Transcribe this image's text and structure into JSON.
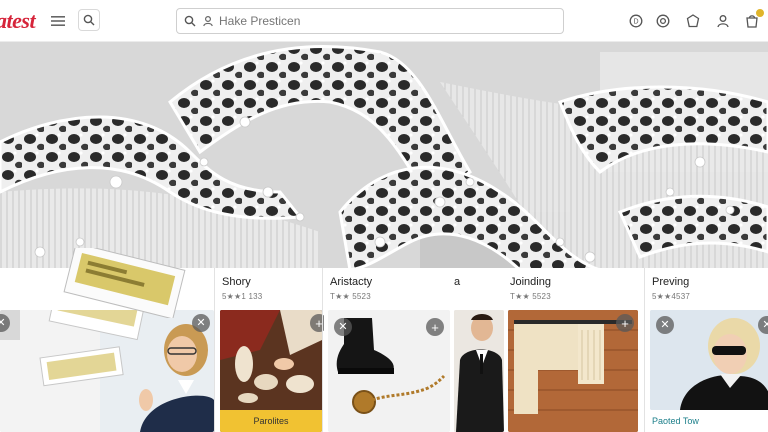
{
  "header": {
    "logo_text": "atest",
    "search_placeholder": "Hake Presticen",
    "icons": [
      "menu-icon",
      "search-icon",
      "coin-icon",
      "settings-icon",
      "shield-icon",
      "user-icon",
      "cart-icon"
    ]
  },
  "hero": {
    "image": "white lattice lace sculpture"
  },
  "cards": [
    {
      "title": "",
      "rating": ""
    },
    {
      "title": "Shory",
      "rating": "5★★1 133",
      "caption": "Parolites"
    },
    {
      "title": "Aristacty",
      "rating": "T★★ 5523"
    },
    {
      "title": "a",
      "rating": ""
    },
    {
      "title": "Joinding",
      "rating": "T★★ 5523"
    },
    {
      "title": "Preving",
      "rating": "5★★4537",
      "caption": "Paoted Tow"
    }
  ],
  "colors": {
    "brand": "#d6243a",
    "caption_yellow": "#f1c232",
    "caption_teal": "#1c7f8a"
  }
}
